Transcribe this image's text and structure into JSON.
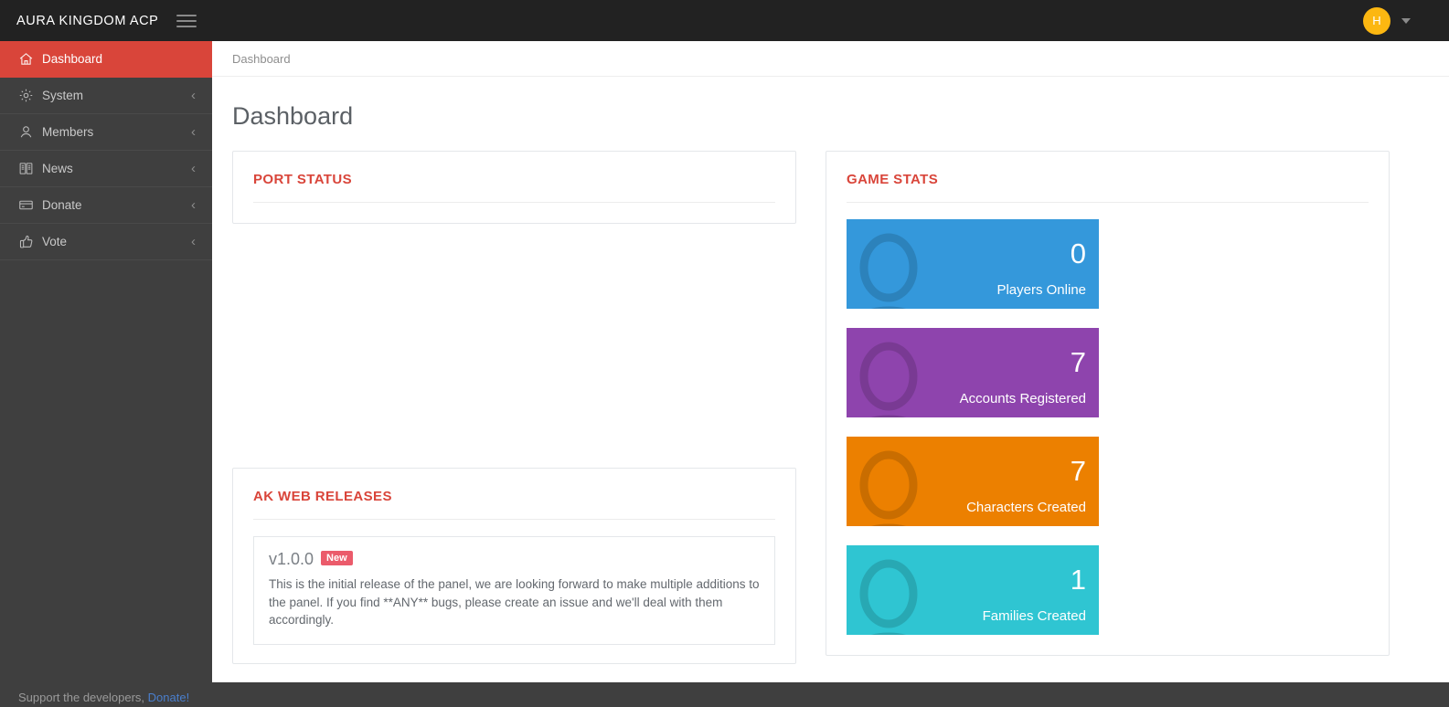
{
  "navbar": {
    "brand": "AURA KINGDOM ACP",
    "menu_toggle_icon": "hamburger-icon",
    "avatar_initial": "H",
    "avatar_color": "#fcb711",
    "caret_icon": "chevron-down-icon"
  },
  "sidebar": {
    "items": [
      {
        "label": "Dashboard",
        "icon": "home-icon",
        "active": true,
        "chevron": ""
      },
      {
        "label": "System",
        "icon": "gear-icon",
        "active": false,
        "chevron": "‹"
      },
      {
        "label": "Members",
        "icon": "user-icon",
        "active": false,
        "chevron": "‹"
      },
      {
        "label": "News",
        "icon": "book-icon",
        "active": false,
        "chevron": "‹"
      },
      {
        "label": "Donate",
        "icon": "credit-card-icon",
        "active": false,
        "chevron": "‹"
      },
      {
        "label": "Vote",
        "icon": "thumbs-up-icon",
        "active": false,
        "chevron": "‹"
      }
    ],
    "active_color": "#d9453a",
    "background": "#3f3f3f"
  },
  "footer": {
    "text": "Support the developers, ",
    "link_label": "Donate!",
    "link_color": "#4a7ecb"
  },
  "content": {
    "breadcrumb": "Dashboard",
    "page_title": "Dashboard"
  },
  "port_status": {
    "title": "PORT STATUS",
    "rows": []
  },
  "game_stats": {
    "title": "GAME STATS",
    "tiles": [
      {
        "value": "0",
        "label": "Players Online",
        "color": "#3498db",
        "icon": "user-silhouette-icon"
      },
      {
        "value": "7",
        "label": "Accounts Registered",
        "color": "#8e44ad",
        "icon": "user-silhouette-icon"
      },
      {
        "value": "7",
        "label": "Characters Created",
        "color": "#ec8000",
        "icon": "user-silhouette-icon"
      },
      {
        "value": "1",
        "label": "Families Created",
        "color": "#2fc5d2",
        "icon": "user-silhouette-icon"
      }
    ]
  },
  "releases": {
    "title": "AK WEB RELEASES",
    "items": [
      {
        "version": "v1.0.0",
        "badge": "New",
        "badge_color": "#eb5b6b",
        "body": "This is the initial release of the panel, we are looking forward to make multiple additions to the panel. If you find **ANY** bugs, please create an issue and we'll deal with them accordingly."
      }
    ]
  }
}
